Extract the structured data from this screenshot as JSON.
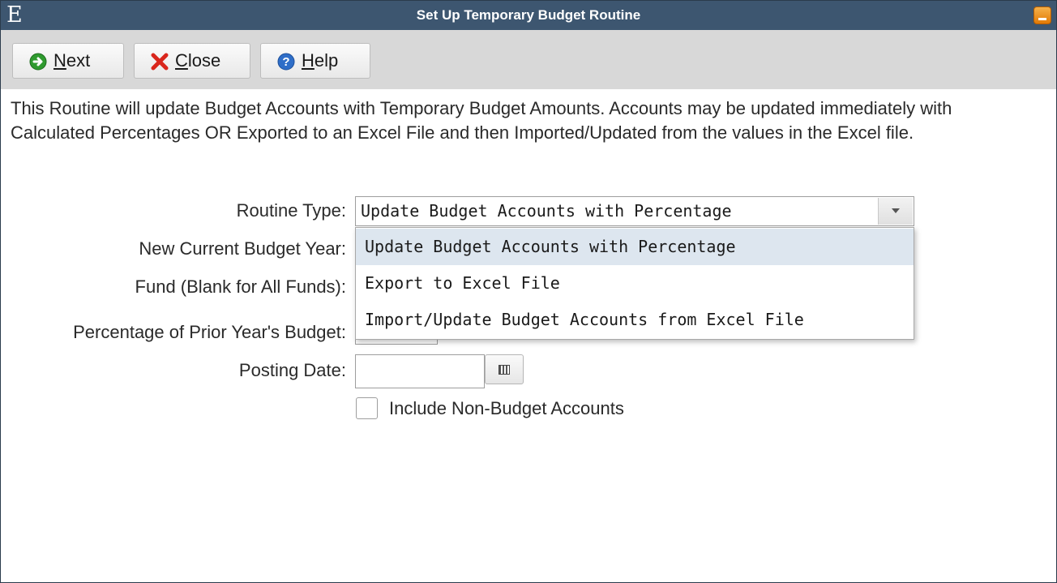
{
  "window": {
    "logo": "E",
    "title": "Set Up Temporary Budget Routine"
  },
  "toolbar": {
    "next": {
      "mnemonic": "N",
      "rest": "ext"
    },
    "close": {
      "mnemonic": "C",
      "rest": "lose"
    },
    "help": {
      "mnemonic": "H",
      "rest": "elp"
    }
  },
  "description": "This Routine will update Budget Accounts with Temporary Budget Amounts.  Accounts may be updated immediately with Calculated Percentages OR Exported to an Excel File and then Imported/Updated from the values in the Excel file.",
  "form": {
    "routine_type_label": "Routine Type:",
    "routine_type_value": "Update Budget Accounts with Percentage",
    "routine_type_options": [
      "Update Budget Accounts with Percentage",
      "Export to Excel File",
      "Import/Update Budget Accounts from Excel File"
    ],
    "new_budget_year_label": "New Current Budget Year:",
    "fund_label": "Fund (Blank for All Funds):",
    "percentage_label": "Percentage of Prior Year's Budget:",
    "posting_date_label": "Posting Date:",
    "posting_date_value": "",
    "include_non_budget_label": "Include Non-Budget Accounts",
    "include_non_budget_checked": false
  },
  "colors": {
    "titlebar": "#3d5670",
    "toolbar": "#d8d8d8",
    "selected_option": "#dde6ef",
    "minimize": "#e98a12"
  },
  "icons": {
    "next": "green-arrow-right-icon",
    "close": "red-x-icon",
    "help": "blue-question-icon",
    "calendar": "calendar-icon"
  }
}
